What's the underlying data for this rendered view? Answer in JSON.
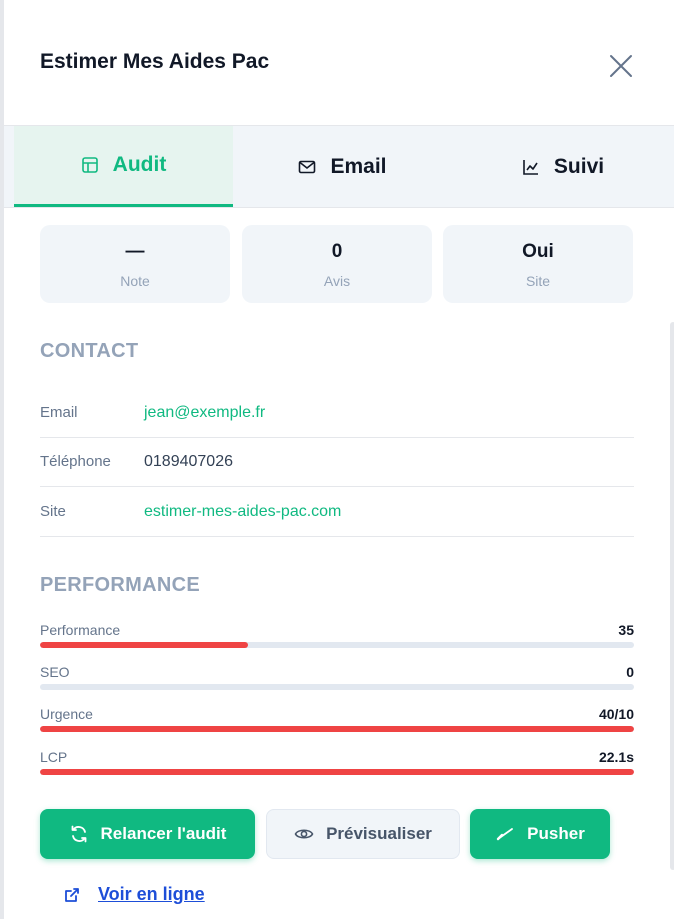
{
  "header": {
    "title": "Estimer Mes Aides Pac"
  },
  "tabs": [
    {
      "label": "Audit",
      "icon": "table-icon",
      "active": true
    },
    {
      "label": "Email",
      "icon": "mail-icon",
      "active": false
    },
    {
      "label": "Suivi",
      "icon": "chart-line-icon",
      "active": false
    }
  ],
  "stats": [
    {
      "value": "—",
      "label": "Note"
    },
    {
      "value": "0",
      "label": "Avis"
    },
    {
      "value": "Oui",
      "label": "Site"
    }
  ],
  "contact": {
    "title": "CONTACT",
    "rows": [
      {
        "label": "Email",
        "value": "jean@exemple.fr"
      },
      {
        "label": "Téléphone",
        "value": "0189407026"
      },
      {
        "label": "Site",
        "value": "estimer-mes-aides-pac.com"
      }
    ]
  },
  "performance": {
    "title": "PERFORMANCE",
    "metrics": [
      {
        "label": "Performance",
        "value": "35",
        "fill_fraction": 0.35
      },
      {
        "label": "SEO",
        "value": "0",
        "fill_fraction": 0
      },
      {
        "label": "Urgence",
        "value": "40/10",
        "fill_fraction": 1
      },
      {
        "label": "LCP",
        "value": "22.1s",
        "fill_fraction": 1
      }
    ]
  },
  "actions": {
    "relaunch_label": "Relancer l'audit",
    "preview_label": "Prévisualiser",
    "push_label": "Pusher",
    "online_label": "Voir en ligne"
  },
  "colors": {
    "accent": "#10b981",
    "danger": "#ef4444",
    "link": "#1d4ed8"
  }
}
